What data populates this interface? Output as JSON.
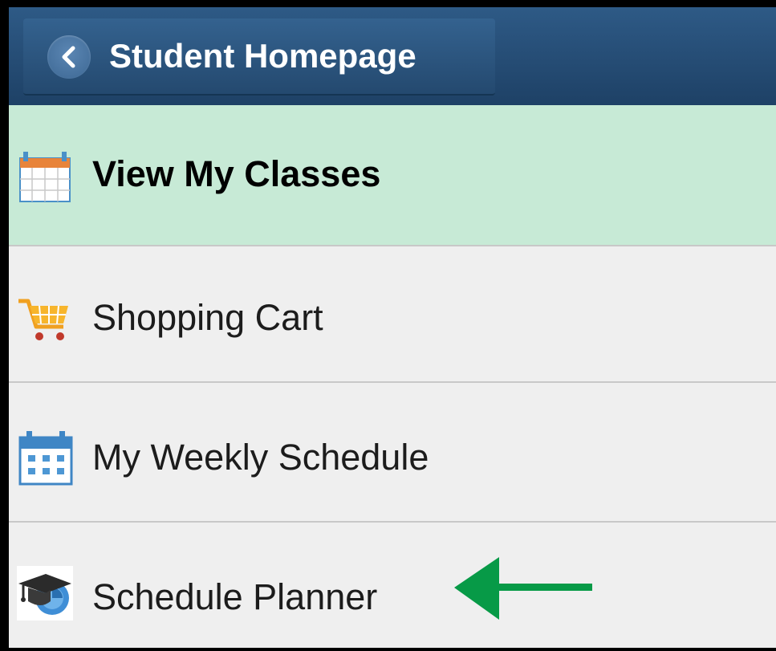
{
  "header": {
    "back_label": "Student Homepage",
    "back_icon": "chevron-left-icon",
    "background": "#244a71"
  },
  "menu": {
    "items": [
      {
        "label": "View My Classes",
        "icon": "calendar-icon",
        "active": true
      },
      {
        "label": "Shopping Cart",
        "icon": "shopping-cart-icon",
        "active": false
      },
      {
        "label": "My Weekly Schedule",
        "icon": "weekly-calendar-icon",
        "active": false
      },
      {
        "label": "Schedule Planner",
        "icon": "graduation-cap-icon",
        "active": false
      }
    ]
  },
  "annotation": {
    "icon": "arrow-left-icon",
    "color": "#079a47"
  },
  "colors": {
    "active_row": "#c7ead6",
    "row_background": "#efefef"
  }
}
